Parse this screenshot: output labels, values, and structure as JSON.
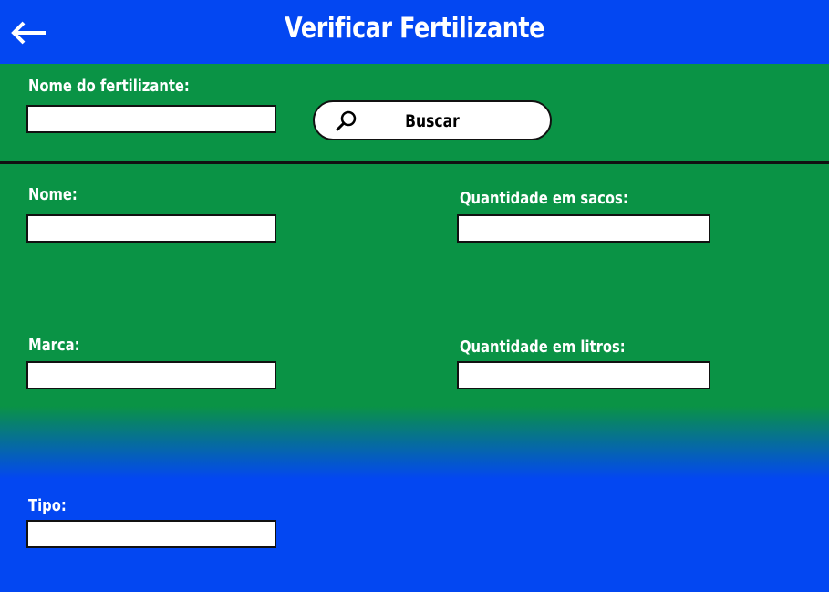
{
  "header": {
    "title": "Verificar Fertilizante",
    "back_icon": "arrow-left-icon"
  },
  "search": {
    "label": "Nome do fertilizante:",
    "value": "",
    "button_label": "Buscar",
    "button_icon": "search-icon"
  },
  "form": {
    "nome_label": "Nome:",
    "marca_label": "Marca:",
    "tipo_label": "Tipo:",
    "quantidade_sacos_label": "Quantidade em sacos:",
    "quantidade_litros_label": "Quantidade em litros:"
  },
  "colors": {
    "header": "#0347f2",
    "background_green": "#0a9345",
    "background_blue": "#0347f2",
    "text": "#ffffff"
  }
}
